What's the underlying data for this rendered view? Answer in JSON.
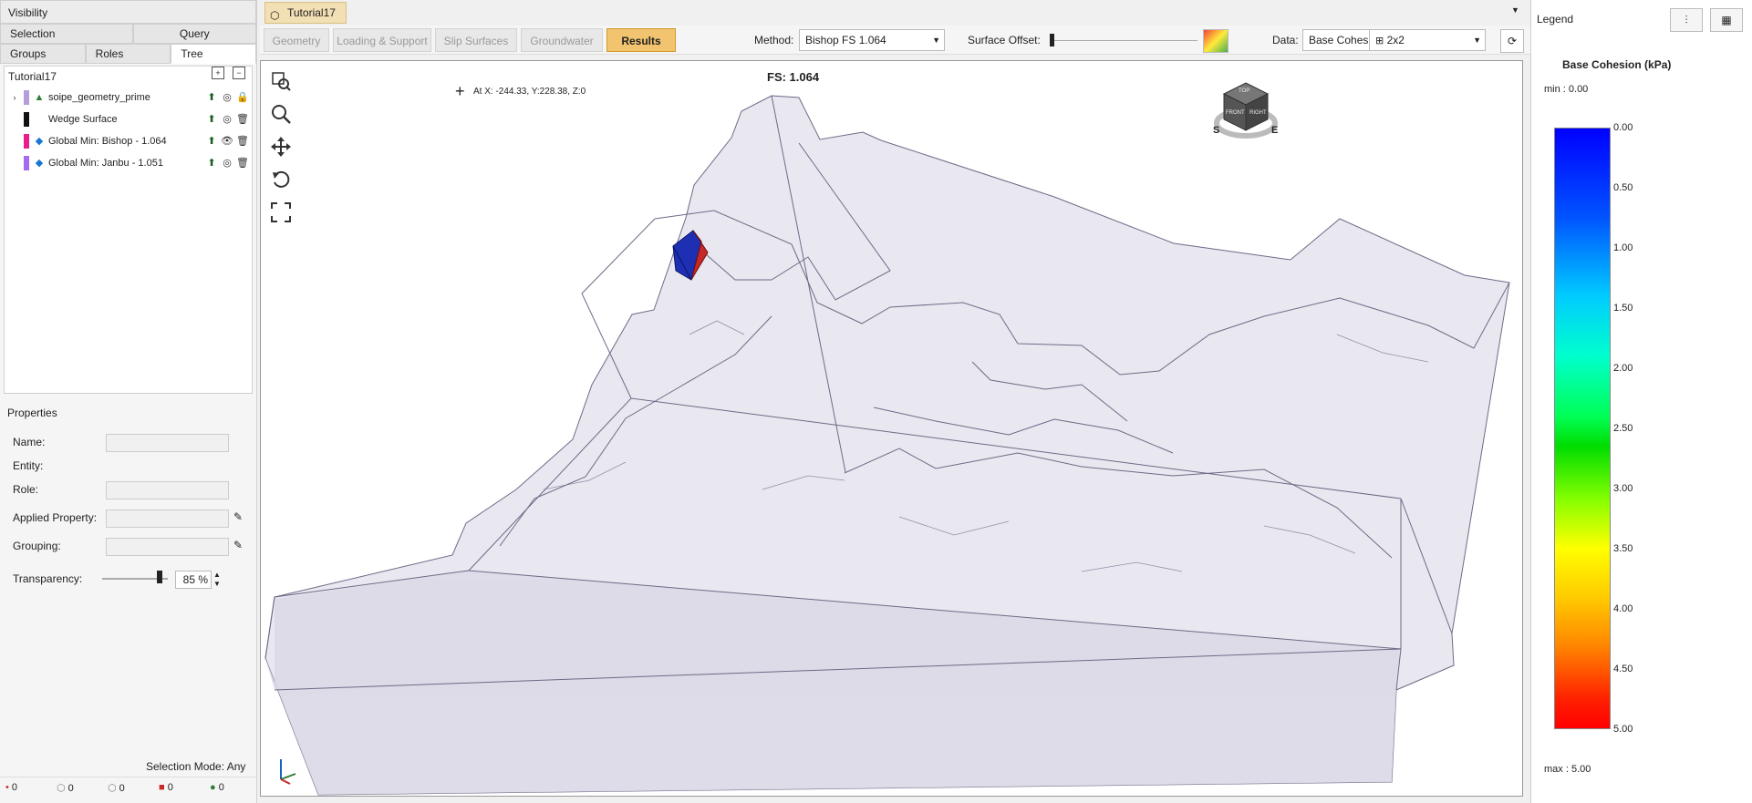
{
  "left": {
    "visibility_title": "Visibility",
    "tabs_top": [
      "Selection",
      "Query"
    ],
    "tabs_bottom": [
      "Groups",
      "Roles",
      "Tree"
    ],
    "tree_root": "Tutorial17",
    "tree_items": [
      {
        "label": "soipe_geometry_prime",
        "color": "#b39ddb"
      },
      {
        "label": "Wedge Surface",
        "color": "#111111"
      },
      {
        "label": "Global Min: Bishop  -  1.064",
        "color": "#e91e8c"
      },
      {
        "label": "Global Min: Janbu  -  1.051",
        "color": "#a36cf0"
      }
    ],
    "properties_title": "Properties",
    "props": {
      "name": "Name:",
      "entity": "Entity:",
      "role": "Role:",
      "applied": "Applied Property:",
      "grouping": "Grouping:",
      "transparency": "Transparency:",
      "transparency_value": "85 %"
    },
    "selection_mode": "Selection Mode: Any",
    "status_counts": [
      "0",
      "0",
      "0",
      "0",
      "0"
    ]
  },
  "main": {
    "doc_tab": "Tutorial17",
    "breadcrumbs": [
      "Geometry",
      "Loading & Support",
      "Slip Surfaces",
      "Groundwater",
      "Results"
    ],
    "method_label": "Method:",
    "method_value": "Bishop FS    1.064",
    "surface_offset_label": "Surface Offset:",
    "data_label": "Data:",
    "data_value": "Base Cohesion",
    "layout_value": "2x2",
    "fs_title": "FS: 1.064",
    "coords": "At X: -244.33, Y:228.38, Z:0",
    "cube_labels": [
      "TOP",
      "FRONT",
      "RIGHT",
      "S",
      "E"
    ]
  },
  "legend": {
    "title": "Legend",
    "heading": "Base Cohesion (kPa)",
    "min": "min :   0.00",
    "max": "max :  5.00",
    "ticks": [
      "0.00",
      "0.50",
      "1.00",
      "1.50",
      "2.00",
      "2.50",
      "3.00",
      "3.50",
      "4.00",
      "4.50",
      "5.00"
    ]
  }
}
